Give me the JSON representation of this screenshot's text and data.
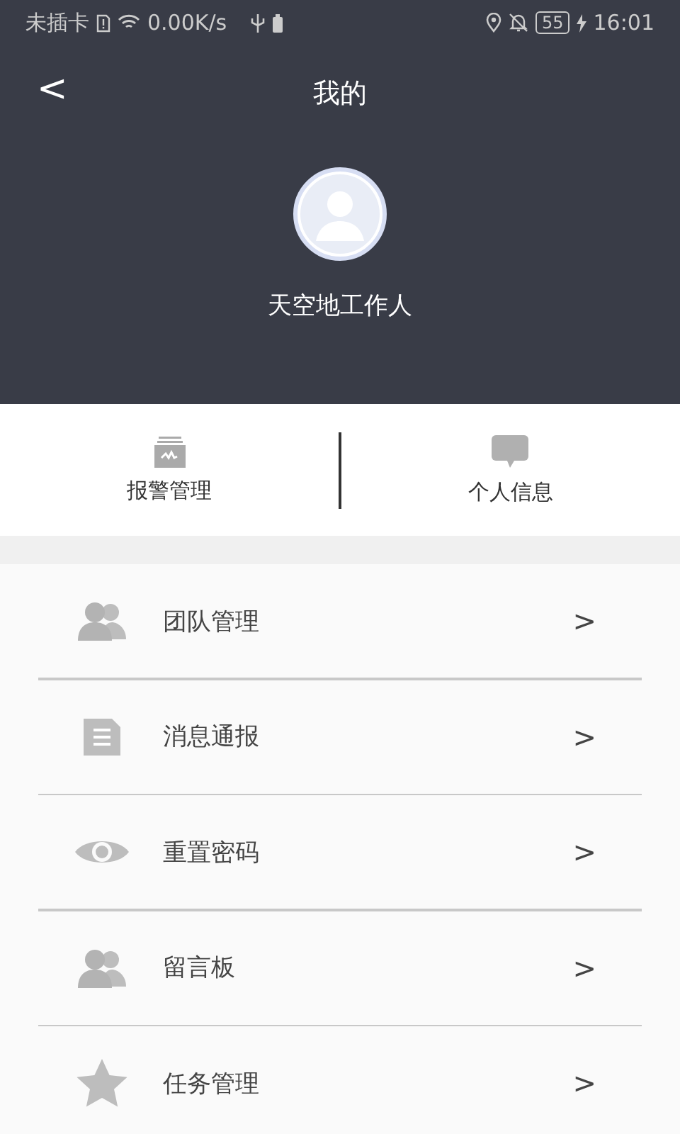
{
  "status_bar": {
    "carrier": "未插卡",
    "speed": "0.00K/s",
    "battery": "55",
    "time": "16:01"
  },
  "header": {
    "back": "<",
    "title": "我的",
    "user_name": "天空地工作人"
  },
  "quick_actions": [
    {
      "kind": "alarm",
      "label": "报警管理"
    },
    {
      "kind": "chat",
      "label": "个人信息"
    }
  ],
  "menu": [
    {
      "kind": "people",
      "label": "团队管理",
      "chevron": ">"
    },
    {
      "kind": "doc",
      "label": "消息通报",
      "chevron": ">"
    },
    {
      "kind": "eye",
      "label": "重置密码",
      "chevron": ">"
    },
    {
      "kind": "people",
      "label": "留言板",
      "chevron": ">"
    },
    {
      "kind": "star",
      "label": "任务管理",
      "chevron": ">"
    }
  ]
}
